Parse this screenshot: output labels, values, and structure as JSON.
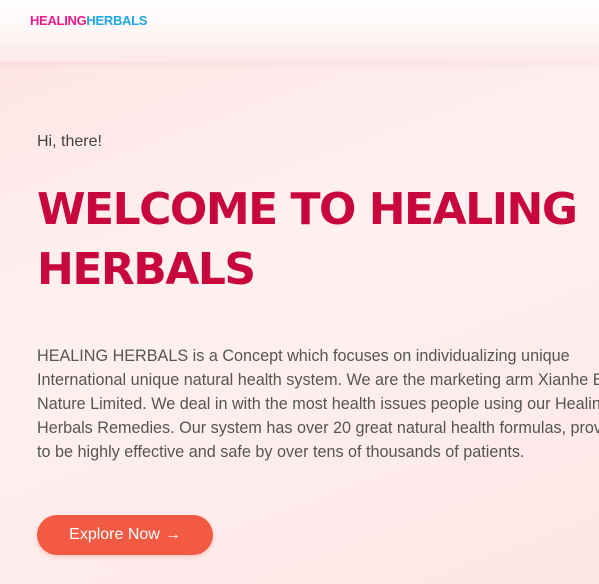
{
  "header": {
    "logo_part1": "HEALING",
    "logo_part2": "HERBALS",
    "logo_colors": {
      "part1": "#ec1c8c",
      "part2": "#1fa7e6"
    }
  },
  "hero": {
    "greeting": "Hi, there!",
    "title": "WELCOME TO HEALING HERBALS",
    "intro": "HEALING HERBALS is a Concept which focuses on individualizing unique International unique natural health system. We are the marketing arm Xianhe By-Nature Limited. We deal in with the most health issues people using our Healing Herbals Remedies. Our system has over 20 great natural health formulas, proven to be highly effective and safe by over tens of thousands of patients.",
    "cta_label": "Explore Now",
    "cta_icon": "arrow-right-icon"
  },
  "colors": {
    "headline": "#c8073d",
    "cta_background": "#f25a44",
    "body_text": "#555555"
  }
}
